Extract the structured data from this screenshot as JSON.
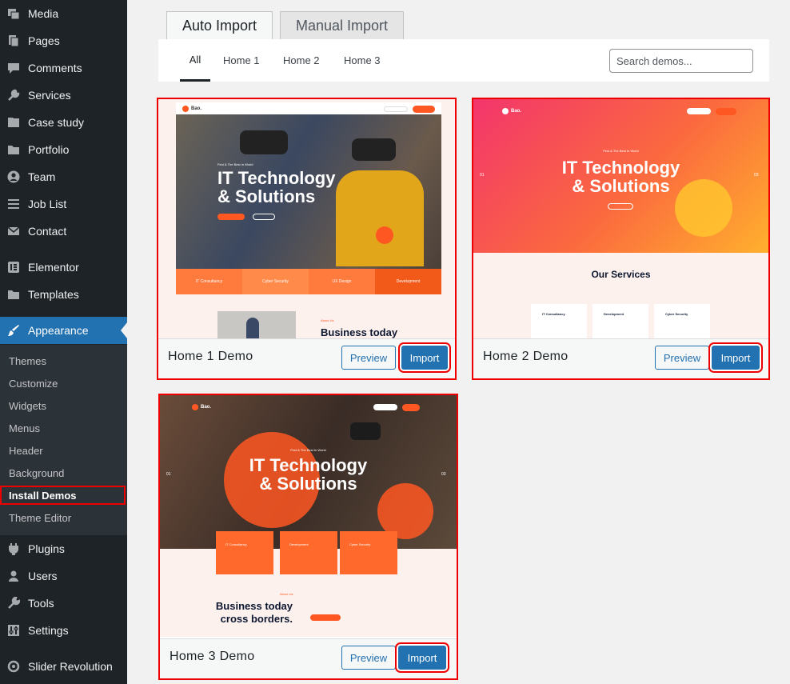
{
  "sidebar": {
    "top_items": [
      {
        "label": "Media",
        "icon": "media-icon"
      },
      {
        "label": "Pages",
        "icon": "pages-icon"
      },
      {
        "label": "Comments",
        "icon": "comments-icon"
      },
      {
        "label": "Services",
        "icon": "services-icon"
      },
      {
        "label": "Case study",
        "icon": "case-study-icon"
      },
      {
        "label": "Portfolio",
        "icon": "portfolio-icon"
      },
      {
        "label": "Team",
        "icon": "team-icon"
      },
      {
        "label": "Job List",
        "icon": "job-list-icon"
      },
      {
        "label": "Contact",
        "icon": "contact-icon"
      },
      {
        "label": "Elementor",
        "icon": "elementor-icon"
      },
      {
        "label": "Templates",
        "icon": "templates-icon"
      },
      {
        "label": "Appearance",
        "icon": "appearance-icon"
      }
    ],
    "submenu": [
      "Themes",
      "Customize",
      "Widgets",
      "Menus",
      "Header",
      "Background",
      "Install Demos",
      "Theme Editor"
    ],
    "bottom_items": [
      {
        "label": "Plugins",
        "icon": "plugins-icon"
      },
      {
        "label": "Users",
        "icon": "users-icon"
      },
      {
        "label": "Tools",
        "icon": "tools-icon"
      },
      {
        "label": "Settings",
        "icon": "settings-icon"
      },
      {
        "label": "Slider Revolution",
        "icon": "slider-revolution-icon"
      }
    ]
  },
  "tabs": {
    "auto": "Auto Import",
    "manual": "Manual Import"
  },
  "filters": [
    "All",
    "Home 1",
    "Home 2",
    "Home 3"
  ],
  "search": {
    "placeholder": "Search demos..."
  },
  "demos": [
    {
      "title": "Home 1 Demo",
      "preview": "Preview",
      "import": "Import",
      "shot": {
        "logo": "Bao.",
        "hero_tag": "First & The Best In World",
        "hero_line1": "IT Technology",
        "hero_line2": "& Solutions",
        "features": [
          "IT Consultancy",
          "Cyber Security",
          "UX Design",
          "Development"
        ],
        "about_tag": "About Us",
        "about_title": "Business today"
      }
    },
    {
      "title": "Home 2 Demo",
      "preview": "Preview",
      "import": "Import",
      "shot": {
        "logo": "Bao.",
        "hero_tag": "First & The Best In World",
        "hero_line1": "IT Technology",
        "hero_line2": "& Solutions",
        "slide_prev": "01",
        "slide_next": "03",
        "services_title": "Our Services",
        "services": [
          "IT Consultancy",
          "Development",
          "Cyber Security"
        ]
      }
    },
    {
      "title": "Home 3 Demo",
      "preview": "Preview",
      "import": "Import",
      "shot": {
        "logo": "Bao.",
        "hero_tag": "First & The Best In World",
        "hero_line1": "IT Technology",
        "hero_line2": "& Solutions",
        "slide_prev": "01",
        "slide_next": "03",
        "services": [
          "IT Consultancy",
          "Development",
          "Cyber Security"
        ],
        "about_tag": "About Us",
        "about_line1": "Business today",
        "about_line2": "cross borders."
      }
    }
  ],
  "colors": {
    "accent": "#2271b1",
    "highlight": "#ee0000",
    "brand_orange": "#ff5722"
  }
}
